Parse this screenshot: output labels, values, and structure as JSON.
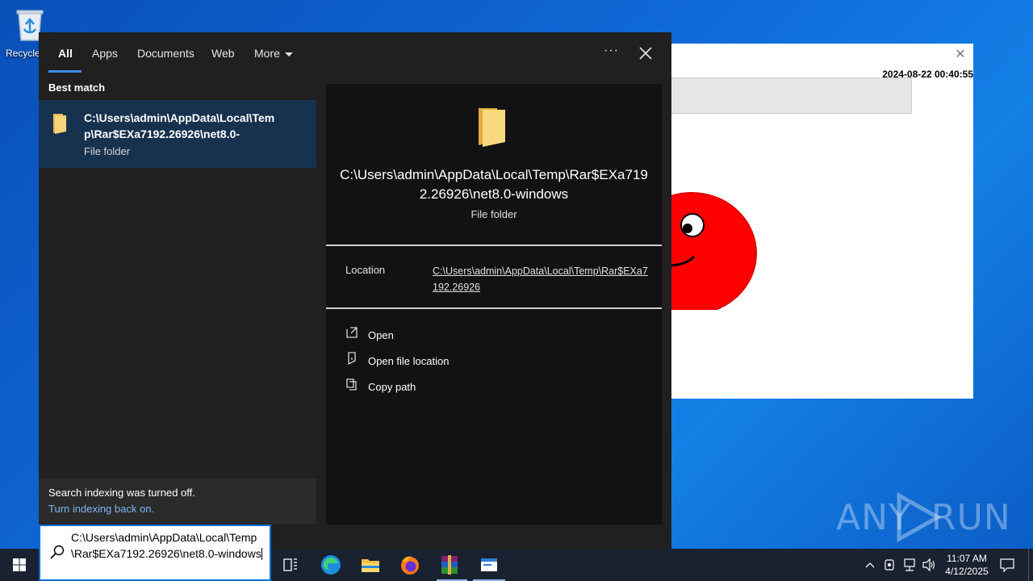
{
  "desktop": {
    "recycle_bin_label": "Recycle"
  },
  "background_app": {
    "timestamp": "2024-08-22 00:40:55",
    "close_glyph": "✕"
  },
  "watermark": {
    "text": "ANY RUN",
    "left": "ANY",
    "right": "RUN"
  },
  "search": {
    "tabs": [
      {
        "label": "All",
        "active": true
      },
      {
        "label": "Apps"
      },
      {
        "label": "Documents"
      },
      {
        "label": "Web"
      },
      {
        "label": "More"
      }
    ],
    "more_options_glyph": "···",
    "best_match_heading": "Best match",
    "best_match": {
      "title": "C:\\Users\\admin\\AppData\\Local\\Temp\\Rar$EXa7192.26926\\net8.0-",
      "subtitle": "File folder",
      "icon": "folder-icon"
    },
    "indexing": {
      "message": "Search indexing was turned off.",
      "link": "Turn indexing back on."
    },
    "preview": {
      "title": "C:\\Users\\admin\\AppData\\Local\\Temp\\Rar$EXa7192.26926\\net8.0-windows",
      "subtitle": "File folder",
      "location_label": "Location",
      "location_value": "C:\\Users\\admin\\AppData\\Local\\Temp\\Rar$EXa7192.26926",
      "actions": [
        {
          "label": "Open",
          "icon": "open-icon"
        },
        {
          "label": "Open file location",
          "icon": "file-location-icon"
        },
        {
          "label": "Copy path",
          "icon": "copy-icon"
        }
      ]
    },
    "query": "C:\\Users\\admin\\AppData\\Local\\Temp\\Rar$EXa7192.26926\\net8.0-windows"
  },
  "taskbar": {
    "pinned": [
      "task-view-icon",
      "edge-icon",
      "file-explorer-icon",
      "firefox-icon",
      "winrar-icon",
      "app-window-icon"
    ],
    "clock_time": "11:07 AM",
    "clock_date": "4/12/2025"
  },
  "colors": {
    "accent": "#3a8ee6",
    "flyout_bg": "#202020",
    "selected_bg": "#17324f",
    "link": "#7fb5ef"
  }
}
